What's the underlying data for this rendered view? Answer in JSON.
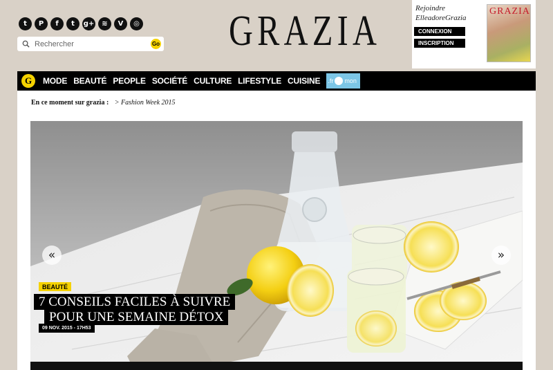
{
  "header": {
    "logo": "GRAZIA",
    "socials": [
      {
        "icon": "tumblr-icon",
        "glyph": "t"
      },
      {
        "icon": "pinterest-icon",
        "glyph": "P"
      },
      {
        "icon": "facebook-icon",
        "glyph": "f"
      },
      {
        "icon": "twitter-icon",
        "glyph": "t"
      },
      {
        "icon": "google-plus-icon",
        "glyph": "g+"
      },
      {
        "icon": "rss-icon",
        "glyph": "≋"
      },
      {
        "icon": "vine-icon",
        "glyph": "V"
      },
      {
        "icon": "instagram-icon",
        "glyph": "◎"
      }
    ],
    "search": {
      "placeholder": "Rechercher",
      "go_label": "Go"
    },
    "join": {
      "line1": "Rejoindre",
      "line2": "ElleadoreGrazia",
      "connect_label": "CONNEXION",
      "signup_label": "INSCRIPTION",
      "cover_title": "GRAZIA"
    }
  },
  "nav": {
    "home_glyph": "G",
    "items": [
      "MODE",
      "BEAUTÉ",
      "PEOPLE",
      "SOCIÉTÉ",
      "CULTURE",
      "LIFESTYLE",
      "CUISINE"
    ],
    "partner_label": ".fr",
    "partner_label2": "mon"
  },
  "moment": {
    "label": "En ce moment sur grazia :",
    "link": "> Fashion Week 2015"
  },
  "hero": {
    "category": "BEAUTÉ",
    "title_line1": "7 CONSEILS FACILES À SUIVRE",
    "title_line2": "POUR UNE SEMAINE DÉTOX",
    "date": "09 NOV. 2015 - 17H53",
    "prev_glyph": "«",
    "next_glyph": "»"
  },
  "colors": {
    "background": "#d9d1c7",
    "accent": "#f5d200",
    "nav": "#000000"
  }
}
